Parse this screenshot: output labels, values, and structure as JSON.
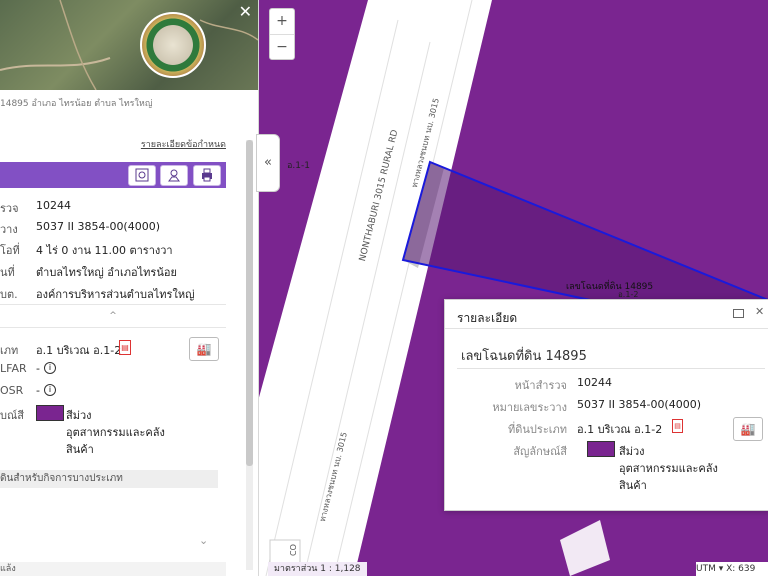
{
  "map": {
    "road_label": "NONTHABURI 3015 RURAL RD",
    "road_label_thai_1": "ทางหลวงชนบท นบ. 3015",
    "road_label_thai_2": "ทางหลวงชนบท นบ. 3015",
    "zone_label": "อ.1-1",
    "parcel_label": "เลขโฉนดที่ดิน 14895",
    "parcel_small": "อ.1-2",
    "bottom_stub": "CO",
    "scale_text": "มาตราส่วน 1 : 1,128",
    "coords_text": "UTM ▾   X: 639",
    "colors": {
      "land_use": "#7a2590",
      "parcel_outline": "#1a1adb",
      "road": "#ffffff"
    }
  },
  "panel": {
    "address": "14895 อำเภอ ไทรน้อย ตำบล ไทรใหญ่",
    "detail_link": "รายละเอียดข้อกำหนด",
    "toolbar_icons": [
      "map-pin-icon",
      "land-icon",
      "print-icon"
    ],
    "rows": [
      {
        "label": "รวจ",
        "value": "10244"
      },
      {
        "label": "วาง",
        "value": "5037 II 3854-00(4000)"
      },
      {
        "label": "โอที่",
        "value": "4 ไร่ 0 งาน 11.00 ตารางวา"
      },
      {
        "label": "นที่",
        "value": "ตำบลไทรใหญ่ อำเภอไทรน้อย"
      },
      {
        "label": "บต.",
        "value": "องค์การบริหารส่วนตำบลไทรใหญ่"
      }
    ],
    "collapse_arrow": "^",
    "zoning": {
      "type_label": "เภท",
      "type_value": "อ.1 บริเวณ อ.1-2",
      "far_label": "LFAR",
      "far_value": "-",
      "osr_label": "OSR",
      "osr_value": "-",
      "symbol_label": "บณ์สี",
      "color_name": "สีม่วง",
      "description_line1": "อุตสาหกรรมและคลัง",
      "description_line2": "สินค้า"
    },
    "section_title": "ดินสำหรับกิจการบางประเภท",
    "expand_arrow": "⌄",
    "bottom_label": "แล้ง"
  },
  "popup": {
    "title": "รายละเอียด",
    "heading": "เลขโฉนดที่ดิน 14895",
    "labels": {
      "survey": "หน้าสำรวจ",
      "sheet": "หมายเลขระวาง",
      "land_type": "ที่ดินประเภท",
      "symbol": "สัญลักษณ์สี"
    },
    "values": {
      "survey": "10244",
      "sheet": "5037 II 3854-00(4000)",
      "land_type": "อ.1 บริเวณ อ.1-2",
      "color_name": "สีม่วง",
      "description_line1": "อุตสาหกรรมและคลัง",
      "description_line2": "สินค้า"
    }
  },
  "controls": {
    "zoom_in": "+",
    "zoom_out": "−",
    "collapse": "«"
  }
}
